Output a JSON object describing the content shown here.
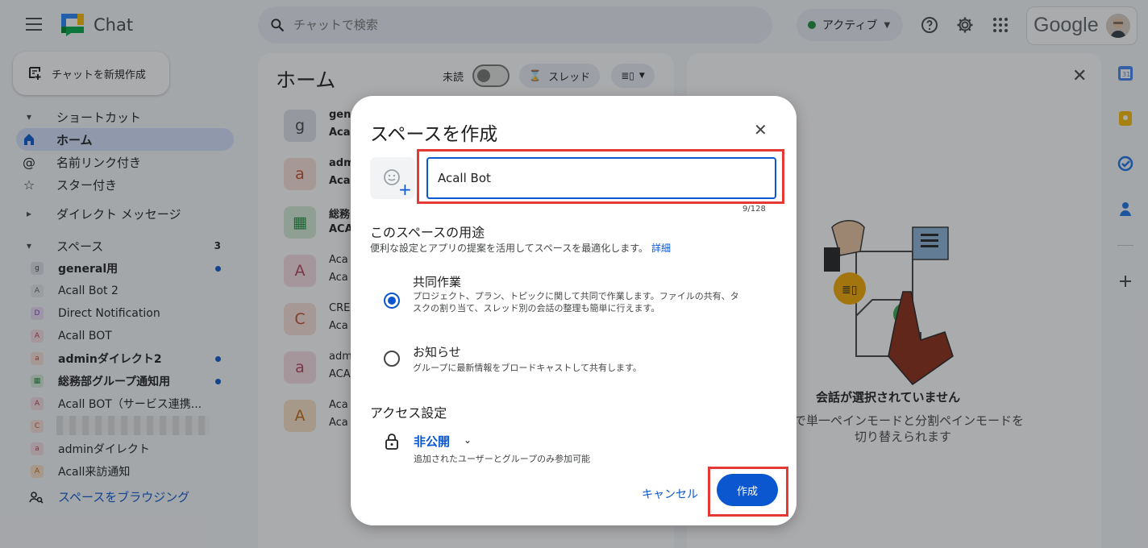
{
  "header": {
    "app_title": "Chat",
    "search_placeholder": "チャットで検索",
    "status_label": "アクティブ",
    "google_label": "Google"
  },
  "sidebar": {
    "new_chat_label": "チャットを新規作成",
    "shortcuts_label": "ショートカット",
    "home_label": "ホーム",
    "mentions_label": "名前リンク付き",
    "starred_label": "スター付き",
    "dm_label": "ダイレクト メッセージ",
    "spaces_label": "スペース",
    "spaces_count": "3",
    "spaces": [
      {
        "initial": "g",
        "name": "general用"
      },
      {
        "initial": "A",
        "name": "Acall Bot 2"
      },
      {
        "initial": "D",
        "name": "Direct Notification"
      },
      {
        "initial": "A",
        "name": "Acall BOT"
      },
      {
        "initial": "a",
        "name": "adminダイレクト2"
      },
      {
        "initial": "",
        "name": "総務部グループ通知用"
      },
      {
        "initial": "A",
        "name": "Acall BOT（サービス連携..."
      },
      {
        "initial": "C",
        "name": ""
      },
      {
        "initial": "a",
        "name": "adminダイレクト"
      },
      {
        "initial": "A",
        "name": "Acall来訪通知"
      }
    ],
    "browse_label": "スペースをブラウジング"
  },
  "home": {
    "title": "ホーム",
    "unread_label": "未読",
    "thread_label": "スレッド",
    "conversations": [
      {
        "initial": "g",
        "line1": "gen",
        "line2": "Aca"
      },
      {
        "initial": "a",
        "line1": "adm",
        "line2": "Aca"
      },
      {
        "initial": "",
        "line1": "総務",
        "line2": "ACA"
      },
      {
        "initial": "A",
        "line1": "Aca",
        "line2": "Aca"
      },
      {
        "initial": "C",
        "line1": "CRE",
        "line2": "Aca"
      },
      {
        "initial": "a",
        "line1": "adm",
        "line2": "ACA"
      },
      {
        "initial": "A",
        "line1": "Aca",
        "line2": "Aca"
      }
    ]
  },
  "right_panel": {
    "empty_title": "会話が選択されていません",
    "empty_desc": "ンで単一ペインモードと分割ペインモードを切り替えられます"
  },
  "dialog": {
    "title": "スペースを作成",
    "name_value": "Acall Bot",
    "char_count": "9/128",
    "purpose_heading": "このスペースの用途",
    "purpose_sub": "便利な設定とアプリの提案を活用してスペースを最適化します。",
    "details_link": "詳細",
    "option_collab_title": "共同作業",
    "option_collab_desc": "プロジェクト、プラン、トピックに関して共同で作業します。ファイルの共有、タスクの割り当て、スレッド別の会話の整理も簡単に行えます。",
    "option_announce_title": "お知らせ",
    "option_announce_desc": "グループに最新情報をブロードキャストして共有します。",
    "access_heading": "アクセス設定",
    "access_value": "非公開",
    "access_desc": "追加されたユーザーとグループのみ参加可能",
    "cancel_label": "キャンセル",
    "create_label": "作成"
  },
  "colors": {
    "accent": "#0b57d0",
    "highlight_frame": "#e53935",
    "active_nav": "#d3e3fd"
  }
}
